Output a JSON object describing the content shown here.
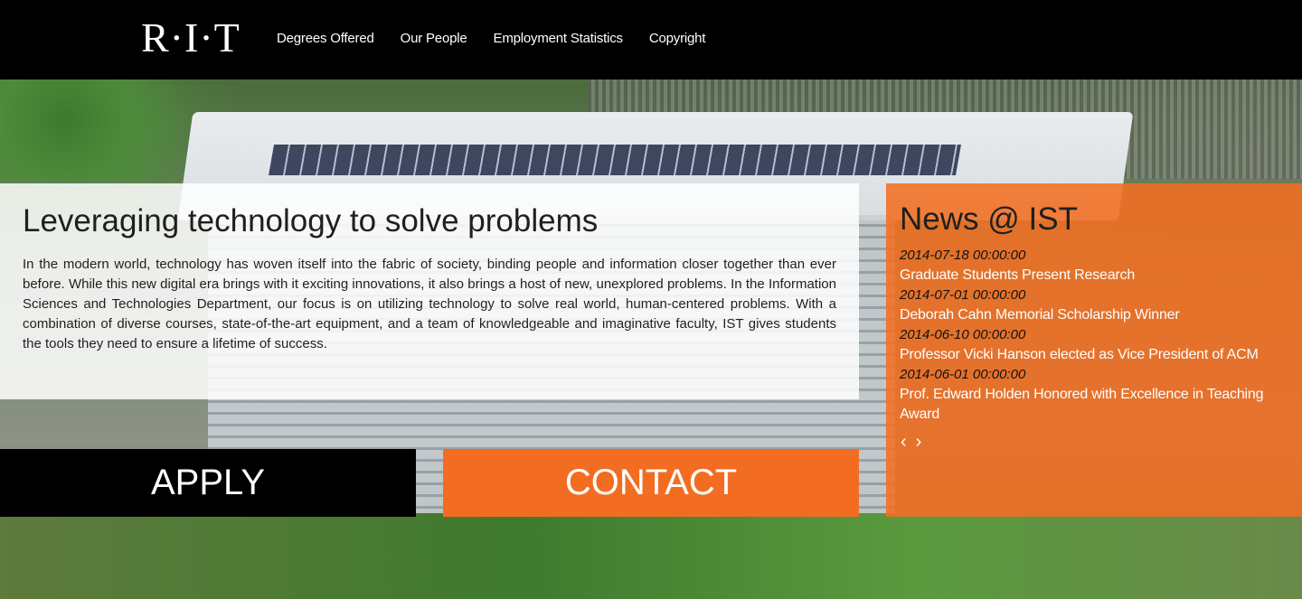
{
  "header": {
    "logo_text": "R·I·T",
    "nav": [
      {
        "label": "Degrees Offered"
      },
      {
        "label": "Our People"
      },
      {
        "label": "Employment Statistics"
      },
      {
        "label": "Copyright"
      }
    ]
  },
  "intro": {
    "title": "Leveraging technology to solve problems",
    "body": "In the modern world, technology has woven itself into the fabric of society, binding people and information closer together than ever before. While this new digital era brings with it exciting innovations, it also brings a host of new, unexplored problems. In the Information Sciences and Technologies Department, our focus is on utilizing technology to solve real world, human-centered problems. With a combination of diverse courses, state-of-the-art equipment, and a team of knowledgeable and imaginative faculty, IST gives students the tools they need to ensure a lifetime of success."
  },
  "buttons": {
    "apply_label": "APPLY",
    "contact_label": "CONTACT"
  },
  "news": {
    "title": "News @ IST",
    "items": [
      {
        "date": "2014-07-18 00:00:00",
        "title": "Graduate Students Present Research"
      },
      {
        "date": "2014-07-01 00:00:00",
        "title": "Deborah Cahn Memorial Scholarship Winner"
      },
      {
        "date": "2014-06-10 00:00:00",
        "title": "Professor Vicki Hanson elected as Vice President of ACM"
      },
      {
        "date": "2014-06-01 00:00:00",
        "title": "Prof. Edward Holden Honored with Excellence in Teaching Award"
      }
    ],
    "prev_icon": "‹",
    "next_icon": "›"
  },
  "colors": {
    "accent_orange": "#f26d21",
    "header_bg": "#000000"
  }
}
